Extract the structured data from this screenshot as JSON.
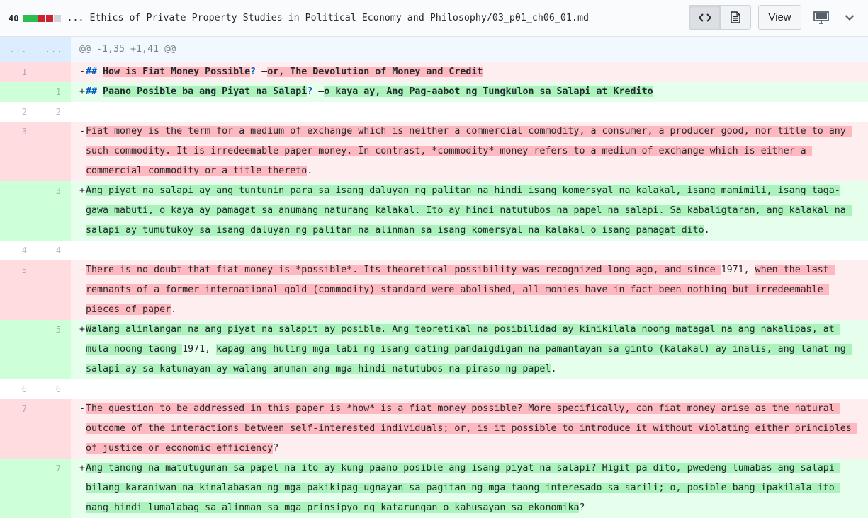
{
  "header": {
    "diffstat_count": "40",
    "diffstat_colors": [
      "#2cbe4e",
      "#2cbe4e",
      "#cb2431",
      "#cb2431",
      "#d1d5da"
    ],
    "file_path": "... Ethics of Private Property Studies in Political Economy and Philosophy/03_p01_ch06_01.md",
    "view_label": "View",
    "icons": {
      "source": "code-icon",
      "rich": "file-text-icon",
      "display": "desktop-icon",
      "menu": "chevron-down-icon"
    }
  },
  "hunk": {
    "old": "...",
    "new": "...",
    "text": "@@ -1,35 +1,41 @@"
  },
  "lines": [
    {
      "type": "del",
      "old": "1",
      "new": "",
      "marker": "-",
      "hdr": "##",
      "segments": [
        {
          "t": " ",
          "m": false
        },
        {
          "t": "How is Fiat Money Possible",
          "m": true
        },
        {
          "t": "? ",
          "m": false,
          "blue": true
        },
        {
          "t": "—",
          "m": false
        },
        {
          "t": "or, The Devolution of Money and Credit",
          "m": true
        }
      ]
    },
    {
      "type": "add",
      "old": "",
      "new": "1",
      "marker": "+",
      "hdr": "##",
      "segments": [
        {
          "t": " ",
          "m": false
        },
        {
          "t": "Paano Posible ba ang Piyat na Salapi",
          "m": true
        },
        {
          "t": "? ",
          "m": false,
          "blue": true
        },
        {
          "t": "—",
          "m": false
        },
        {
          "t": "o kaya ay, Ang Pag-aabot ng Tungkulon sa Salapi at Kredito",
          "m": true
        }
      ]
    },
    {
      "type": "ctx",
      "old": "2",
      "new": "2",
      "segments": []
    },
    {
      "type": "del",
      "old": "3",
      "new": "",
      "marker": "-",
      "segments": [
        {
          "t": "Fiat money is the term for a medium of exchange which is neither a commercial commodity, a consumer, a producer good, nor title to any such commodity. It is irredeemable paper money. In contrast, *commodity* money refers to a medium of exchange which is either a commercial commodity or a title thereto",
          "m": true
        },
        {
          "t": ".",
          "m": false
        }
      ]
    },
    {
      "type": "add",
      "old": "",
      "new": "3",
      "marker": "+",
      "segments": [
        {
          "t": "Ang piyat na salapi ay ang tuntunin para sa isang daluyan ng palitan na hindi isang komersyal na kalakal, isang mamimili, isang taga-gawa mabuti, o kaya ay pamagat sa anumang naturang kalakal. Ito ay hindi natutubos na papel na salapi. Sa kabaligtaran, ang kalakal na salapi ay tumutukoy sa isang daluyan ng palitan na alinman sa isang komersyal na kalakal o isang pamagat dito",
          "m": true
        },
        {
          "t": ".",
          "m": false
        }
      ]
    },
    {
      "type": "ctx",
      "old": "4",
      "new": "4",
      "segments": []
    },
    {
      "type": "del",
      "old": "5",
      "new": "",
      "marker": "-",
      "segments": [
        {
          "t": "There is no doubt that fiat money is *possible*. Its theoretical possibility was recognized long ago, and since ",
          "m": true
        },
        {
          "t": "1971, ",
          "m": false
        },
        {
          "t": "when the last remnants of a former international gold (commodity) standard were abolished, all monies have in fact been nothing but irredeemable pieces of paper",
          "m": true
        },
        {
          "t": ".",
          "m": false
        }
      ]
    },
    {
      "type": "add",
      "old": "",
      "new": "5",
      "marker": "+",
      "segments": [
        {
          "t": "Walang alinlangan na ang piyat na salapit ay posible. Ang teoretikal na posibilidad ay kinikilala noong matagal na ang nakalipas, at mula noong taong ",
          "m": true
        },
        {
          "t": "1971, ",
          "m": false
        },
        {
          "t": "kapag ang huling mga labi ng isang dating pandaigdigan na pamantayan sa ginto (kalakal) ay inalis, ang lahat ng salapi ay sa katunayan ay walang anuman ang mga hindi natutubos na piraso ng papel",
          "m": true
        },
        {
          "t": ".",
          "m": false
        }
      ]
    },
    {
      "type": "ctx",
      "old": "6",
      "new": "6",
      "segments": []
    },
    {
      "type": "del",
      "old": "7",
      "new": "",
      "marker": "-",
      "segments": [
        {
          "t": "The question to be addressed in this paper is *how* is a fiat money possible? More specifically, can fiat money arise as the natural outcome of the interactions between self-interested individuals; or, is it possible to introduce it without violating either principles of justice or economic efficiency",
          "m": true
        },
        {
          "t": "?",
          "m": false
        }
      ]
    },
    {
      "type": "add",
      "old": "",
      "new": "7",
      "marker": "+",
      "segments": [
        {
          "t": "Ang tanong na matutugunan sa papel na ito ay kung paano posible ang isang piyat na salapi? Higit pa dito, pwedeng lumabas ang salapi bilang karaniwan na kinalabasan ng mga pakikipag-ugnayan sa pagitan ng mga taong interesado sa sarili; o, posible bang ipakilala ito nang hindi lumalabag sa alinman sa mga prinsipyo ng katarungan o kahusayan sa ekonomika",
          "m": true
        },
        {
          "t": "?",
          "m": false
        }
      ]
    }
  ]
}
